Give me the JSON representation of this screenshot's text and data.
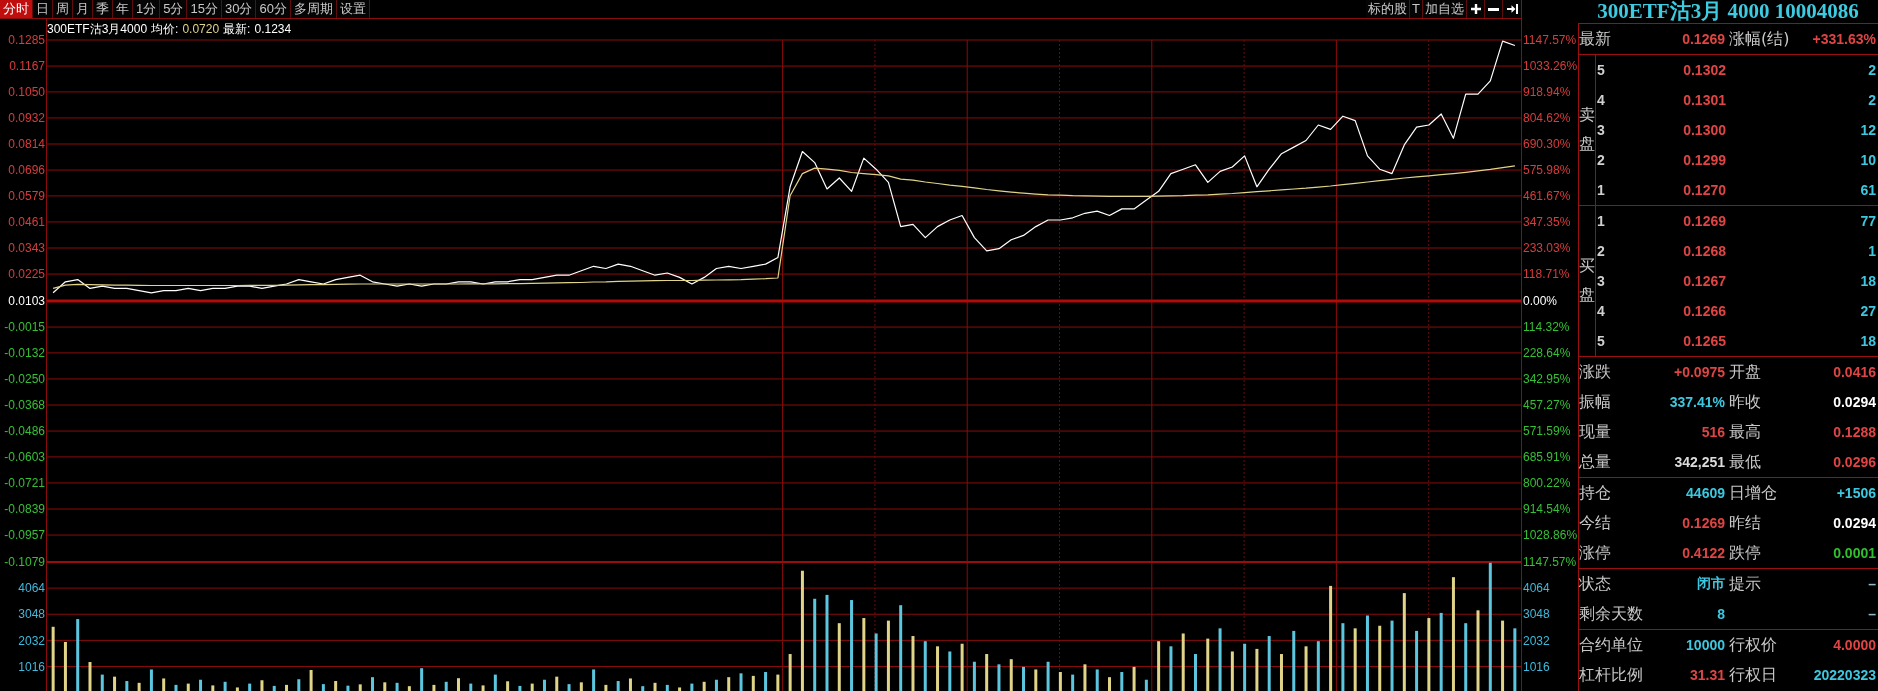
{
  "toolbar": {
    "tabs": [
      {
        "label": "分时",
        "selected": true
      },
      {
        "label": "日",
        "selected": false
      },
      {
        "label": "周",
        "selected": false
      },
      {
        "label": "月",
        "selected": false
      },
      {
        "label": "季",
        "selected": false
      },
      {
        "label": "年",
        "selected": false
      },
      {
        "label": "1分",
        "selected": false
      },
      {
        "label": "5分",
        "selected": false
      },
      {
        "label": "15分",
        "selected": false
      },
      {
        "label": "30分",
        "selected": false
      },
      {
        "label": "60分",
        "selected": false
      },
      {
        "label": "多周期",
        "selected": false
      },
      {
        "label": "设置",
        "selected": false
      }
    ],
    "actions": [
      "标的股",
      "T",
      "加自选"
    ]
  },
  "price_chart": {
    "legend": {
      "name": "300ETF沽3月4000",
      "items": [
        {
          "label": "均价:",
          "value": "0.0720",
          "color": "#e0d488"
        },
        {
          "label": "最新:",
          "value": "0.1234",
          "color": "#ffffff"
        }
      ]
    },
    "chart_data": {
      "type": "line",
      "grid": true,
      "ylim": [
        -0.1079,
        0.1285
      ],
      "yticks": [
        {
          "value": 0.1285,
          "label": "0.1285"
        },
        {
          "value": 0.1167,
          "label": "0.1167"
        },
        {
          "value": 0.105,
          "label": "0.1050"
        },
        {
          "value": 0.0932,
          "label": "0.0932"
        },
        {
          "value": 0.0814,
          "label": "0.0814"
        },
        {
          "value": 0.0696,
          "label": "0.0696"
        },
        {
          "value": 0.0579,
          "label": "0.0579"
        },
        {
          "value": 0.0461,
          "label": "0.0461"
        },
        {
          "value": 0.0343,
          "label": "0.0343"
        },
        {
          "value": 0.0225,
          "label": "0.0225"
        },
        {
          "value": 0.0103,
          "label": "0.0103"
        },
        {
          "value": -0.0015,
          "label": "-0.0015"
        },
        {
          "value": -0.0132,
          "label": "-0.0132"
        },
        {
          "value": -0.025,
          "label": "-0.0250"
        },
        {
          "value": -0.0368,
          "label": "-0.0368"
        },
        {
          "value": -0.0486,
          "label": "-0.0486"
        },
        {
          "value": -0.0603,
          "label": "-0.0603"
        },
        {
          "value": -0.0721,
          "label": "-0.0721"
        },
        {
          "value": -0.0839,
          "label": "-0.0839"
        },
        {
          "value": -0.0957,
          "label": "-0.0957"
        },
        {
          "value": -0.1079,
          "label": "-0.1079"
        }
      ],
      "series": [
        {
          "color": "#ffffff",
          "values": [
            0.014,
            0.019,
            0.02,
            0.016,
            0.017,
            0.016,
            0.016,
            0.015,
            0.014,
            0.015,
            0.015,
            0.016,
            0.015,
            0.016,
            0.016,
            0.017,
            0.017,
            0.016,
            0.017,
            0.018,
            0.02,
            0.019,
            0.018,
            0.02,
            0.021,
            0.022,
            0.019,
            0.018,
            0.017,
            0.018,
            0.017,
            0.018,
            0.018,
            0.019,
            0.019,
            0.018,
            0.019,
            0.019,
            0.02,
            0.02,
            0.021,
            0.022,
            0.022,
            0.024,
            0.026,
            0.025,
            0.027,
            0.026,
            0.024,
            0.022,
            0.023,
            0.021,
            0.018,
            0.021,
            0.025,
            0.026,
            0.025,
            0.026,
            0.027,
            0.03,
            0.062,
            0.078,
            0.073,
            0.061,
            0.066,
            0.06,
            0.075,
            0.07,
            0.064,
            0.044,
            0.045,
            0.039,
            0.044,
            0.047,
            0.049,
            0.039,
            0.033,
            0.034,
            0.038,
            0.04,
            0.044,
            0.047,
            0.047,
            0.048,
            0.05,
            0.051,
            0.049,
            0.052,
            0.052,
            0.056,
            0.06,
            0.068,
            0.07,
            0.072,
            0.064,
            0.069,
            0.071,
            0.076,
            0.062,
            0.07,
            0.077,
            0.08,
            0.083,
            0.09,
            0.088,
            0.094,
            0.092,
            0.076,
            0.07,
            0.068,
            0.081,
            0.089,
            0.09,
            0.095,
            0.084,
            0.104,
            0.104,
            0.11,
            0.128,
            0.126
          ]
        },
        {
          "color": "#e0d488",
          "values": [
            0.016,
            0.0175,
            0.0178,
            0.0177,
            0.0176,
            0.0175,
            0.0175,
            0.0174,
            0.0173,
            0.0173,
            0.0173,
            0.0173,
            0.0173,
            0.0173,
            0.0173,
            0.0173,
            0.0174,
            0.0174,
            0.0174,
            0.0175,
            0.0176,
            0.0177,
            0.0177,
            0.0178,
            0.0179,
            0.018,
            0.018,
            0.018,
            0.018,
            0.018,
            0.018,
            0.018,
            0.018,
            0.018,
            0.0181,
            0.0181,
            0.0181,
            0.0182,
            0.0182,
            0.0183,
            0.0184,
            0.0185,
            0.0186,
            0.0187,
            0.0189,
            0.019,
            0.0192,
            0.0193,
            0.0194,
            0.0195,
            0.0196,
            0.0196,
            0.0196,
            0.0197,
            0.0198,
            0.0199,
            0.02,
            0.0202,
            0.0204,
            0.0207,
            0.058,
            0.068,
            0.0705,
            0.07,
            0.0695,
            0.0685,
            0.068,
            0.0675,
            0.067,
            0.0655,
            0.065,
            0.0642,
            0.0635,
            0.0628,
            0.0622,
            0.0615,
            0.0608,
            0.0602,
            0.0596,
            0.0591,
            0.0587,
            0.0584,
            0.0582,
            0.058,
            0.0579,
            0.0578,
            0.0577,
            0.0577,
            0.0577,
            0.0577,
            0.0578,
            0.0579,
            0.058,
            0.0582,
            0.0584,
            0.0587,
            0.059,
            0.0594,
            0.0598,
            0.0602,
            0.0606,
            0.061,
            0.0614,
            0.0619,
            0.0624,
            0.063,
            0.0636,
            0.0642,
            0.0648,
            0.0654,
            0.066,
            0.0665,
            0.067,
            0.0675,
            0.068,
            0.0686,
            0.0692,
            0.0699,
            0.0707,
            0.0715
          ]
        }
      ],
      "ref_lines": [
        {
          "axis": "y",
          "value": 0.0103
        }
      ]
    },
    "percent_axis": [
      "1147.57%",
      "1033.26%",
      "918.94%",
      "804.62%",
      "690.30%",
      "575.98%",
      "461.67%",
      "347.35%",
      "233.03%",
      "118.71%",
      "0.00%",
      "114.32%",
      "228.64%",
      "342.95%",
      "457.27%",
      "571.59%",
      "685.91%",
      "800.22%",
      "914.54%",
      "1028.86%",
      "1147.57%"
    ]
  },
  "volume_chart": {
    "chart_data": {
      "type": "bar",
      "stacked": true,
      "grid": true,
      "ylim": [
        0,
        5080
      ],
      "yticks": [
        4064,
        3048,
        2032,
        1016
      ],
      "series": [
        {
          "color": "#e0d488",
          "values": [
            2560,
            1970,
            null,
            1190,
            null,
            620,
            null,
            380,
            null,
            550,
            null,
            350,
            null,
            280,
            null,
            200,
            null,
            480,
            null,
            300,
            null,
            880,
            null,
            450,
            null,
            320,
            null,
            400,
            null,
            250,
            null,
            300,
            null,
            560,
            null,
            280,
            null,
            440,
            null,
            350,
            null,
            620,
            null,
            400,
            null,
            300,
            null,
            550,
            null,
            380,
            null,
            200,
            null,
            420,
            null,
            600,
            null,
            650,
            null,
            700,
            1500,
            4740,
            null,
            null,
            2700,
            null,
            2900,
            null,
            2800,
            null,
            2200,
            null,
            1800,
            null,
            1900,
            null,
            1500,
            null,
            1300,
            null,
            900,
            null,
            800,
            null,
            1100,
            null,
            600,
            null,
            1000,
            null,
            2000,
            null,
            2300,
            null,
            2100,
            null,
            1600,
            null,
            1700,
            null,
            1500,
            null,
            1800,
            null,
            4150,
            null,
            2500,
            null,
            2600,
            null,
            3870,
            null,
            2900,
            null,
            4490,
            null,
            3200,
            null,
            2800,
            null
          ]
        },
        {
          "color": "#5cc6de",
          "values": [
            null,
            null,
            2860,
            null,
            700,
            null,
            450,
            null,
            900,
            null,
            300,
            null,
            500,
            null,
            420,
            null,
            350,
            null,
            260,
            null,
            520,
            null,
            330,
            null,
            270,
            null,
            600,
            null,
            380,
            null,
            950,
            null,
            420,
            null,
            350,
            null,
            700,
            null,
            260,
            null,
            500,
            null,
            330,
            null,
            900,
            null,
            450,
            null,
            250,
            null,
            300,
            null,
            350,
            null,
            500,
            null,
            750,
            null,
            800,
            null,
            null,
            null,
            3650,
            3800,
            null,
            3600,
            null,
            2300,
            null,
            3400,
            null,
            2000,
            null,
            1600,
            null,
            1200,
            null,
            1100,
            null,
            1000,
            null,
            1200,
            null,
            700,
            null,
            900,
            null,
            800,
            null,
            500,
            null,
            1800,
            null,
            1500,
            null,
            2500,
            null,
            1900,
            null,
            2200,
            null,
            2400,
            null,
            2000,
            null,
            2700,
            null,
            3000,
            null,
            2800,
            null,
            2400,
            null,
            3100,
            null,
            2700,
            null,
            5050,
            null,
            2500
          ]
        }
      ]
    },
    "right_axis": [
      "4064",
      "3048",
      "2032",
      "1016"
    ]
  },
  "quote_panel": {
    "title": "300ETF沽3月 4000 10004086",
    "summary": [
      {
        "label": "最新",
        "value": "0.1269",
        "color": "#e04444"
      },
      {
        "label": "涨幅(结)",
        "value": "+331.63%",
        "color": "#e04444"
      }
    ],
    "order_book": {
      "asks_label": "卖盘",
      "asks": [
        {
          "level": "5",
          "price": "0.1302",
          "volume": "2"
        },
        {
          "level": "4",
          "price": "0.1301",
          "volume": "2"
        },
        {
          "level": "3",
          "price": "0.1300",
          "volume": "12"
        },
        {
          "level": "2",
          "price": "0.1299",
          "volume": "10"
        },
        {
          "level": "1",
          "price": "0.1270",
          "volume": "61"
        }
      ],
      "bids_label": "买盘",
      "bids": [
        {
          "level": "1",
          "price": "0.1269",
          "volume": "77"
        },
        {
          "level": "2",
          "price": "0.1268",
          "volume": "1"
        },
        {
          "level": "3",
          "price": "0.1267",
          "volume": "18"
        },
        {
          "level": "4",
          "price": "0.1266",
          "volume": "27"
        },
        {
          "level": "5",
          "price": "0.1265",
          "volume": "18"
        }
      ]
    },
    "stats": [
      {
        "rows": [
          [
            {
              "label": "涨跌",
              "value": "+0.0975",
              "color": "#e04444"
            },
            {
              "label": "开盘",
              "value": "0.0416",
              "color": "#e04444"
            }
          ],
          [
            {
              "label": "振幅",
              "value": "337.41%",
              "color": "#3cc8e0"
            },
            {
              "label": "昨收",
              "value": "0.0294",
              "color": "#ffffff"
            }
          ],
          [
            {
              "label": "现量",
              "value": "516",
              "color": "#e04444"
            },
            {
              "label": "最高",
              "value": "0.1288",
              "color": "#e04444"
            }
          ],
          [
            {
              "label": "总量",
              "value": "342,251",
              "color": "#dcdcdc"
            },
            {
              "label": "最低",
              "value": "0.0296",
              "color": "#e04444"
            }
          ]
        ]
      },
      {
        "rows": [
          [
            {
              "label": "持仓",
              "value": "44609",
              "color": "#3cc8e0"
            },
            {
              "label": "日增仓",
              "value": "+1506",
              "color": "#3cc8e0"
            }
          ],
          [
            {
              "label": "今结",
              "value": "0.1269",
              "color": "#e04444"
            },
            {
              "label": "昨结",
              "value": "0.0294",
              "color": "#ffffff"
            }
          ],
          [
            {
              "label": "涨停",
              "value": "0.4122",
              "color": "#e04444"
            },
            {
              "label": "跌停",
              "value": "0.0001",
              "color": "#2fbf2f"
            }
          ]
        ]
      },
      {
        "rows": [
          [
            {
              "label": "状态",
              "value": "闭市",
              "color": "#3cc8e0"
            },
            {
              "label": "提示",
              "value": "–",
              "color": "#8fb8c8"
            }
          ],
          [
            {
              "label": "剩余天数",
              "value": "8",
              "color": "#3cc8e0"
            },
            {
              "value": "–",
              "color": "#8fb8c8"
            }
          ]
        ]
      },
      {
        "rows": [
          [
            {
              "label": "合约单位",
              "value": "10000",
              "color": "#3cc8e0"
            },
            {
              "label": "行权价",
              "value": "4.0000",
              "color": "#e04444"
            }
          ],
          [
            {
              "label": "杠杆比例",
              "value": "31.31",
              "color": "#e04444"
            },
            {
              "label": "行权日",
              "value": "20220323",
              "color": "#3cc8e0"
            }
          ]
        ]
      }
    ]
  }
}
